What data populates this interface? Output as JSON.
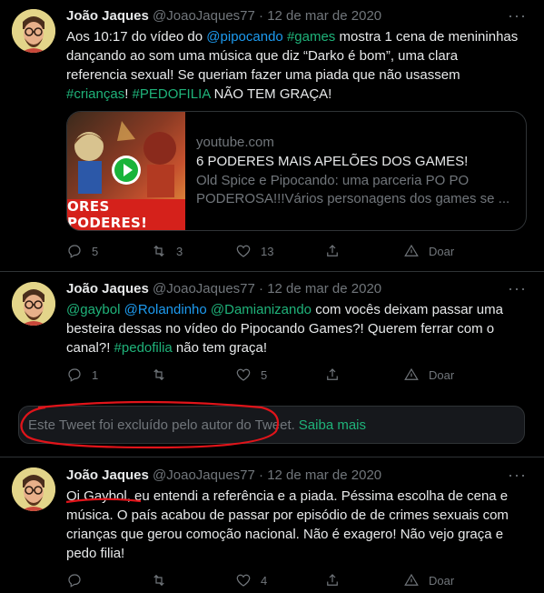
{
  "tweets": [
    {
      "author_name": "João Jaques",
      "handle": "@JoaoJaques77",
      "sep": "·",
      "date": "12 de mar de 2020",
      "more_label": "···",
      "text_parts": [
        {
          "t": "Aos 10:17 do vídeo do "
        },
        {
          "t": "@pipocando",
          "c": "link"
        },
        {
          "t": " "
        },
        {
          "t": "#games",
          "c": "green"
        },
        {
          "t": " mostra 1 cena de menininhas dançando ao som uma música que diz “Darko é bom”, uma clara referencia sexual! Se queriam fazer uma piada que não usassem "
        },
        {
          "t": "#crianças",
          "c": "green"
        },
        {
          "t": "! "
        },
        {
          "t": "#PEDOFILIA",
          "c": "green"
        },
        {
          "t": " NÃO TEM GRAÇA!"
        }
      ],
      "card": {
        "thumb_banner": "ORES PODERES!",
        "domain": "youtube.com",
        "title": "6 PODERES MAIS APELÕES DOS GAMES!",
        "description": "Old Spice e Pipocando: uma parceria PO PO PODEROSA!!!Vários personagens dos games se ..."
      },
      "actions": {
        "reply": "5",
        "retweet": "3",
        "like": "13",
        "share": "",
        "donate": "Doar"
      }
    },
    {
      "author_name": "João Jaques",
      "handle": "@JoaoJaques77",
      "sep": "·",
      "date": "12 de mar de 2020",
      "more_label": "···",
      "text_parts": [
        {
          "t": "@gaybol",
          "c": "green"
        },
        {
          "t": " "
        },
        {
          "t": "@Rolandinho",
          "c": "link"
        },
        {
          "t": " "
        },
        {
          "t": "@Damianizando",
          "c": "green"
        },
        {
          "t": " com vocês deixam passar uma besteira dessas no vídeo do Pipocando Games?! Querem ferrar com o canal?! "
        },
        {
          "t": "#pedofilia",
          "c": "green"
        },
        {
          "t": " não tem graça!"
        }
      ],
      "actions": {
        "reply": "1",
        "retweet": "",
        "like": "5",
        "share": "",
        "donate": "Doar"
      }
    },
    {
      "author_name": "João Jaques",
      "handle": "@JoaoJaques77",
      "sep": "·",
      "date": "12 de mar de 2020",
      "more_label": "···",
      "text_parts": [
        {
          "t": "Oi Gaybol, eu entendi a referência e a piada. Péssima escolha de cena e música. O país acabou de passar por episódio de de crimes sexuais com crianças que gerou comoção nacional. Não é exagero! Não vejo graça e pedo filia!"
        }
      ],
      "actions": {
        "reply": "",
        "retweet": "",
        "like": "4",
        "share": "",
        "donate": "Doar"
      }
    }
  ],
  "deleted_notice": {
    "text": "Este Tweet foi excluído pelo autor do Tweet.",
    "link": "Saiba mais"
  },
  "colors": {
    "background": "#000000",
    "link_blue": "#1d9bf0",
    "hashtag_green": "#1fb37a",
    "muted": "#71767b",
    "annotation_red": "#e0141a"
  }
}
